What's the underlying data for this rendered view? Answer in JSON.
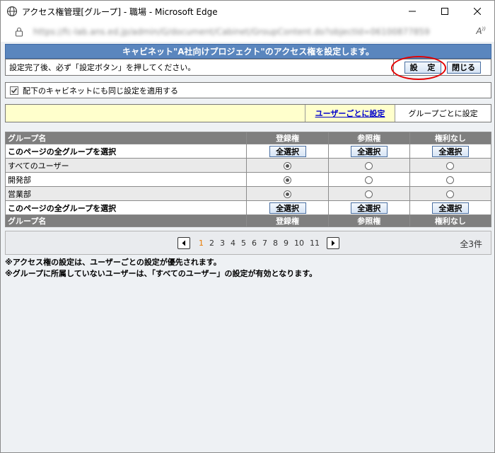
{
  "window": {
    "title": "アクセス権管理[グループ] - 職場 - Microsoft Edge",
    "url": "https://fc-lab.ans.ed.jp/admin/G/document/Cabinet/GroupContent.do?objectId=06100877859"
  },
  "header": {
    "banner": "キャビネット\"A社向けプロジェクト\"のアクセス権を設定します。"
  },
  "notice": {
    "text": "設定完了後、必ず「設定ボタン」を押してください。",
    "set_label": "設 定",
    "close_label": "閉じる"
  },
  "apply_children": {
    "label": "配下のキャビネットにも同じ設定を適用する",
    "checked": true
  },
  "modes": {
    "by_user": "ユーザーごとに設定",
    "by_group": "グループごとに設定"
  },
  "table": {
    "headers": [
      "グループ名",
      "登録権",
      "参照権",
      "権利なし"
    ],
    "select_all_label": "このページの全グループを選択",
    "select_all_button": "全選択",
    "rows": [
      {
        "name": "すべてのユーザー",
        "selected": 0
      },
      {
        "name": "開発部",
        "selected": 0
      },
      {
        "name": "営業部",
        "selected": 0
      }
    ]
  },
  "pager": {
    "pages": [
      "1",
      "2",
      "3",
      "4",
      "5",
      "6",
      "7",
      "8",
      "9",
      "10",
      "11"
    ],
    "current": "1",
    "total": "全3件"
  },
  "notes": [
    "※アクセス権の設定は、ユーザーごとの設定が優先されます。",
    "※グループに所属していないユーザーは、「すべてのユーザー」の設定が有効となります。"
  ]
}
